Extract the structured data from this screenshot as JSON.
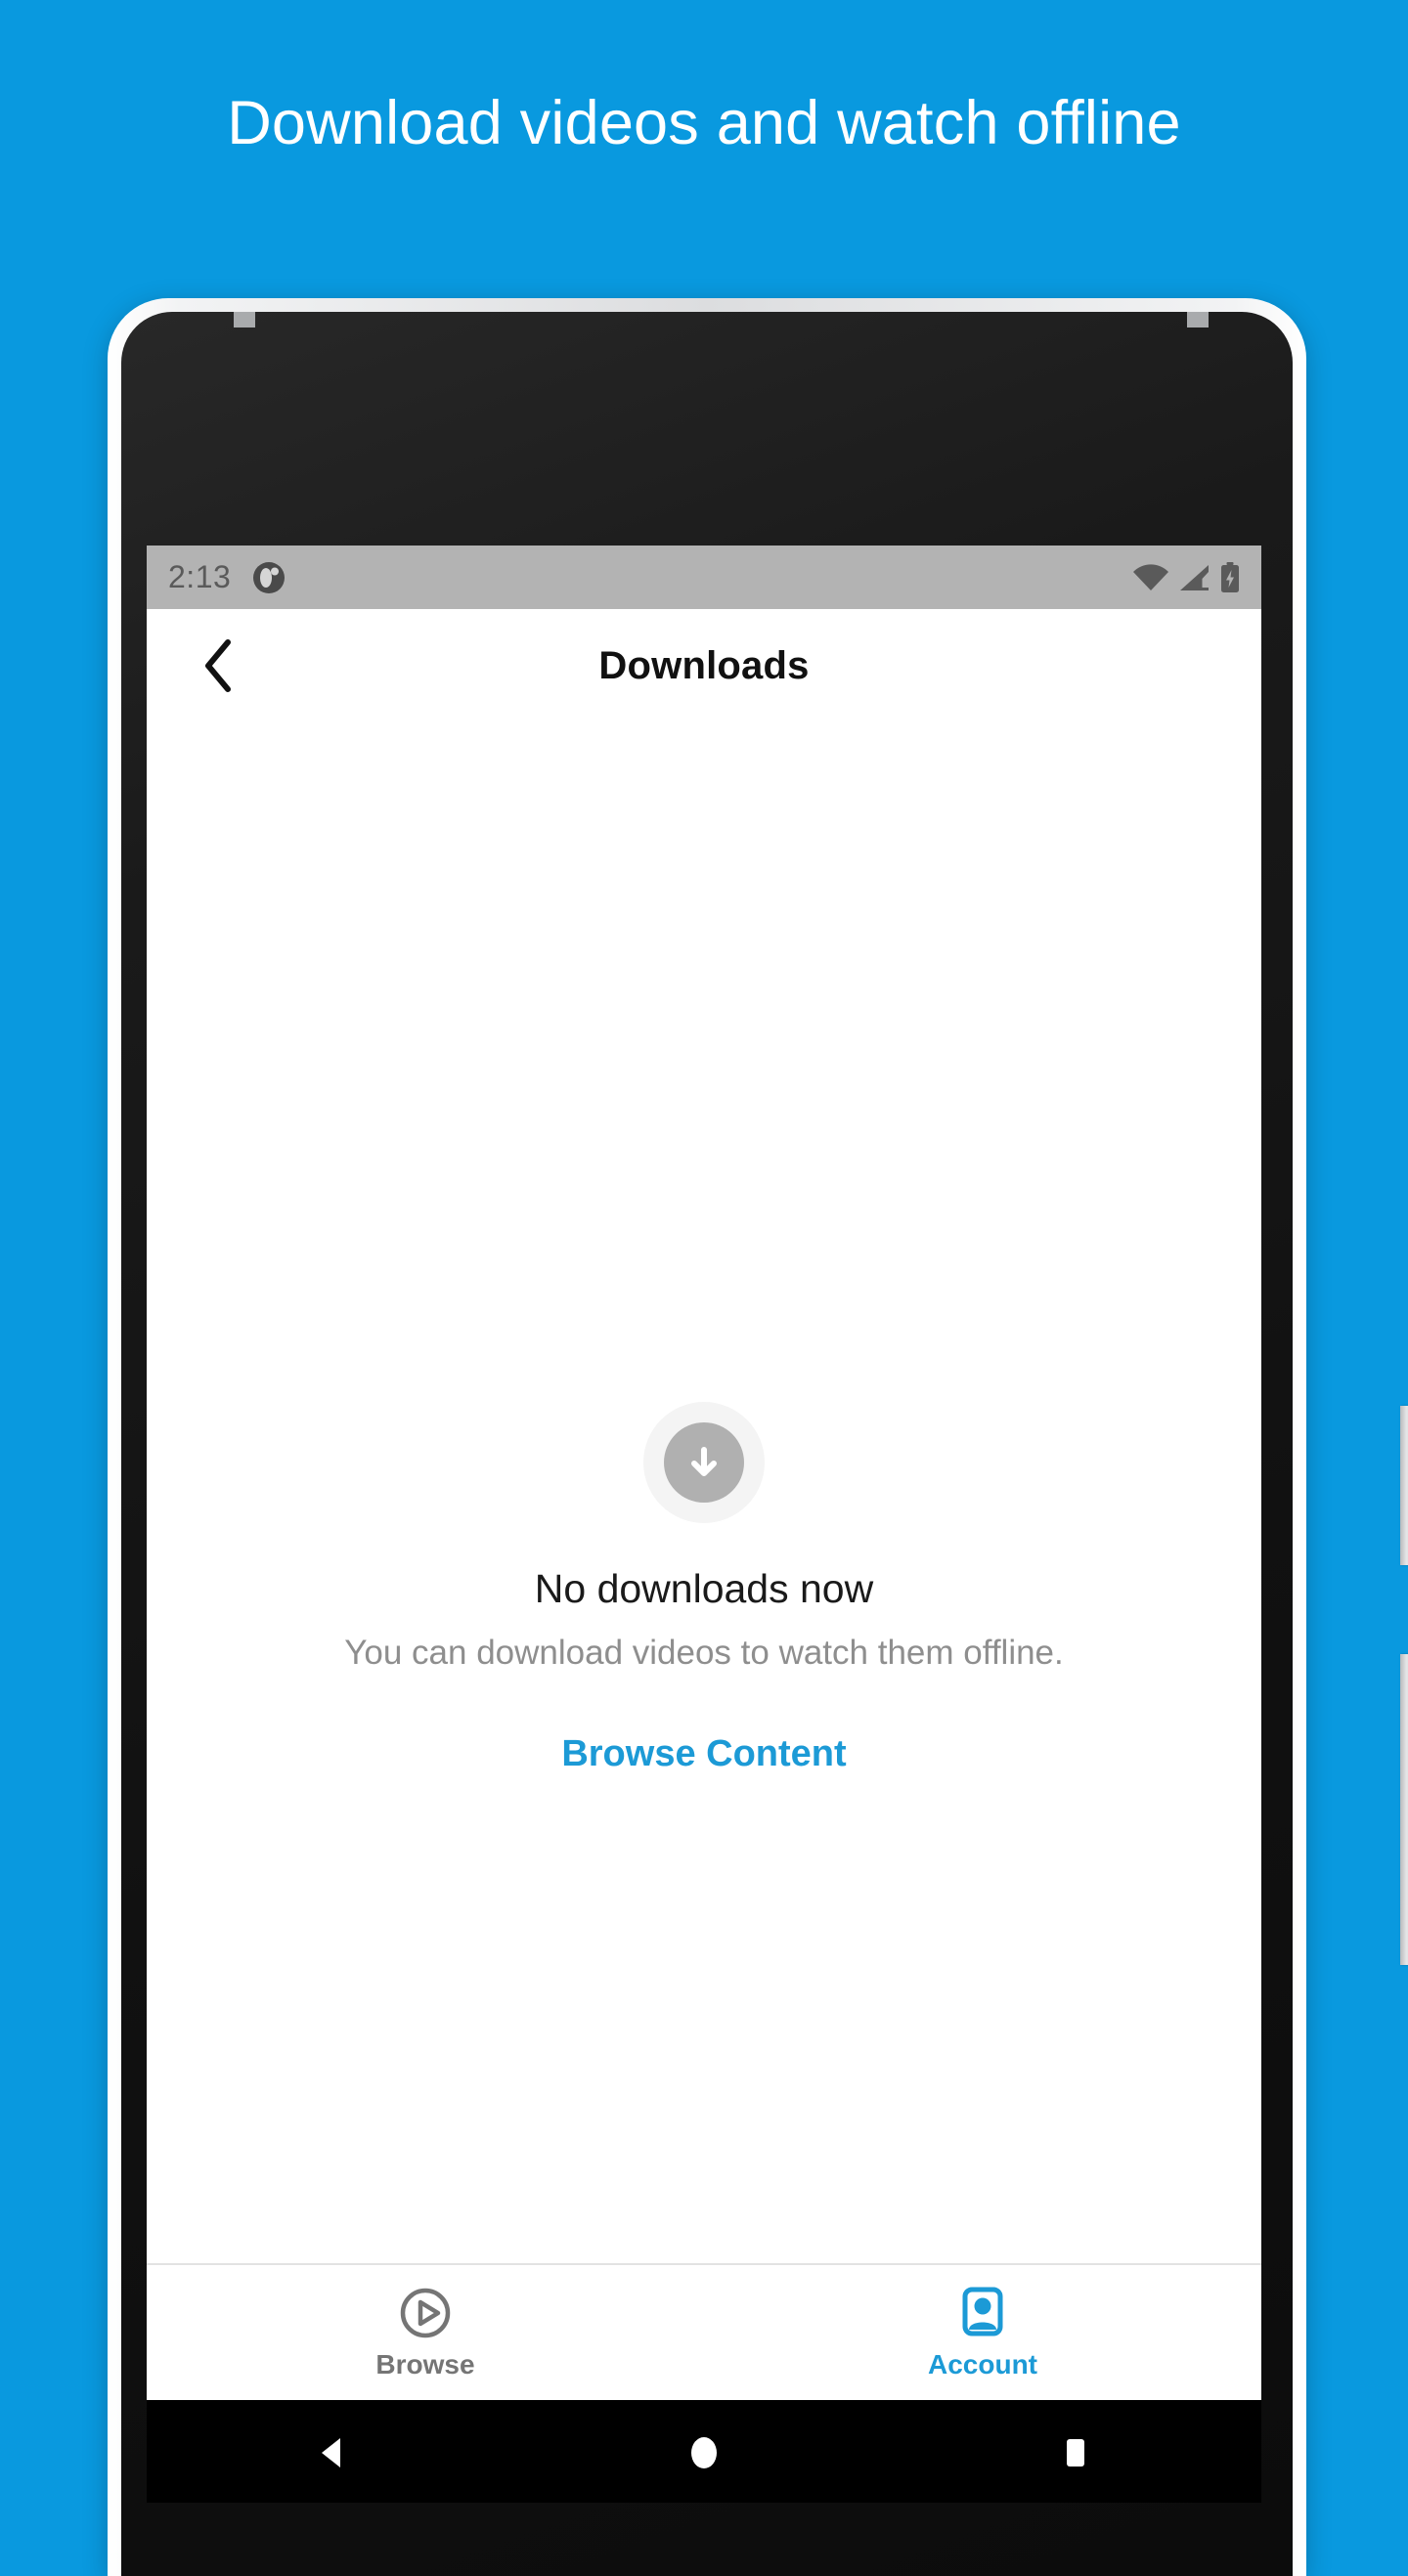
{
  "promo": {
    "headline": "Download videos and watch offline",
    "background_color": "#0999df",
    "text_color": "#ffffff"
  },
  "device": {
    "frame_color": "#dcdddf",
    "face_color": "#161616",
    "buttons": {
      "power": "power-button",
      "volume": "volume-rocker"
    },
    "hardware_icons": [
      "front-camera",
      "earpiece-speaker",
      "antenna-notch"
    ]
  },
  "status_bar": {
    "time": "2:13",
    "background_color": "#b3b3b3",
    "foreground_color": "#5a5a5a",
    "notification_icon": "app-notification-icon",
    "icons": [
      "wifi-icon",
      "cellular-signal-icon",
      "battery-charging-icon"
    ]
  },
  "app_bar": {
    "back_icon": "chevron-left-icon",
    "title": "Downloads"
  },
  "empty_state": {
    "icon": "download-arrow-icon",
    "title": "No downloads now",
    "subtitle": "You can download videos to watch them offline.",
    "cta_label": "Browse Content",
    "cta_color": "#1C9AD6",
    "title_color": "#1a1a1a",
    "subtitle_color": "#8e8e8e"
  },
  "tab_bar": {
    "items": [
      {
        "label": "Browse",
        "icon": "play-circle-icon",
        "active": false,
        "color": "#757575"
      },
      {
        "label": "Account",
        "icon": "account-box-icon",
        "active": true,
        "color": "#1C9AD6"
      }
    ]
  },
  "nav_bar": {
    "background_color": "#000000",
    "buttons": [
      {
        "name": "android-back-button",
        "icon": "triangle-left-icon"
      },
      {
        "name": "android-home-button",
        "icon": "circle-icon"
      },
      {
        "name": "android-recents-button",
        "icon": "square-icon"
      }
    ]
  }
}
